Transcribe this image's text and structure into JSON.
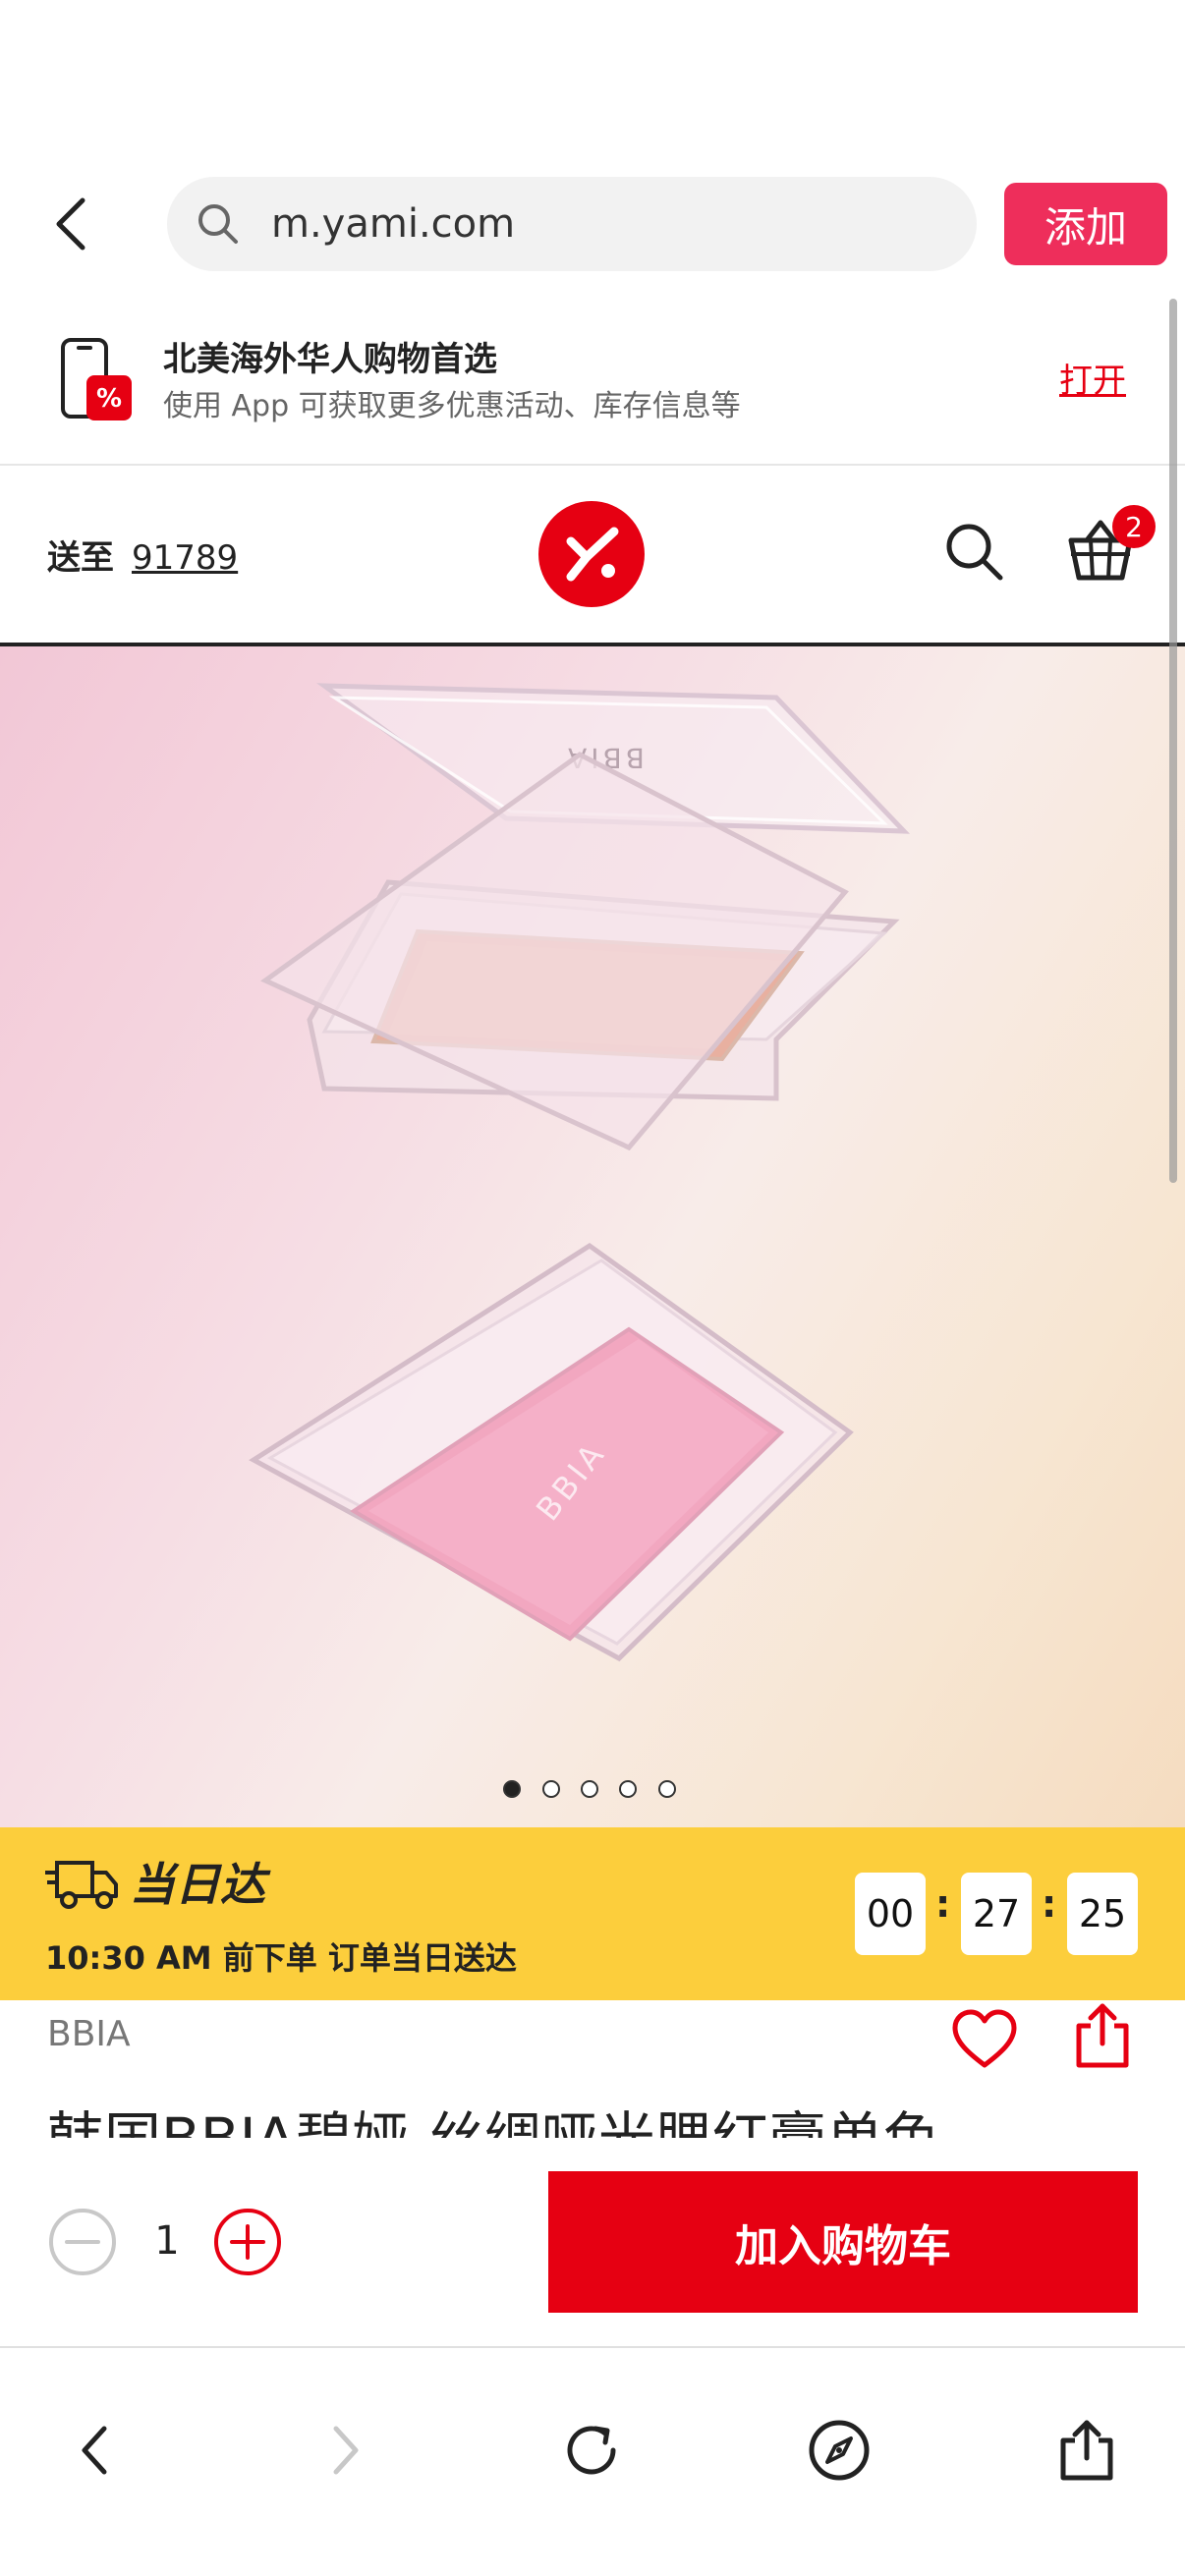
{
  "browser": {
    "url": "m.yami.com",
    "add_label": "添加"
  },
  "app_banner": {
    "title": "北美海外华人购物首选",
    "subtitle": "使用 App 可获取更多优惠活动、库存信息等",
    "open_label": "打开"
  },
  "header": {
    "ship_to_label": "送至",
    "zip": "91789",
    "cart_count": "2"
  },
  "product_image": {
    "brand_mark_top": "BBIA",
    "brand_mark_bottom": "BBIA",
    "carousel": {
      "count": 5,
      "active": 0
    }
  },
  "delivery": {
    "title": "当日达",
    "subtitle": "10:30 AM 前下单 订单当日送达",
    "countdown": {
      "hours": "00",
      "minutes": "27",
      "seconds": "25"
    }
  },
  "product": {
    "brand": "BBIA",
    "title": "韩国BBIA碧娅 丝绸哑光腮红膏单色"
  },
  "cart_bar": {
    "quantity": "1",
    "add_to_cart_label": "加入购物车"
  },
  "colors": {
    "accent": "#e60012",
    "add_button": "#ee2e5b",
    "delivery_banner": "#fcce3c"
  }
}
